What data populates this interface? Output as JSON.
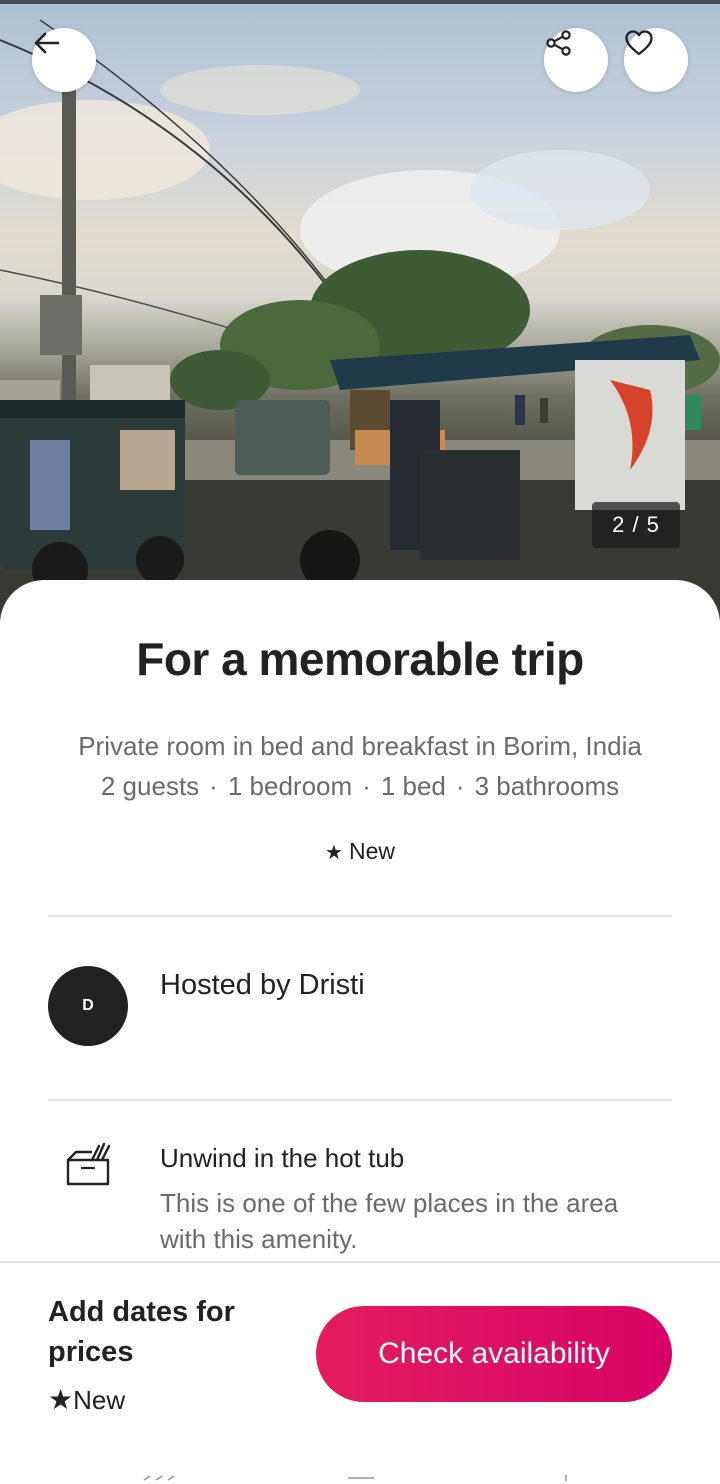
{
  "photo": {
    "counter": "2 / 5",
    "current_index": 2,
    "total": 5
  },
  "listing": {
    "title": "For a memorable trip",
    "subtitle": "Private room in bed and breakfast in Borim, India",
    "details": [
      "2 guests",
      "1 bedroom",
      "1 bed",
      "3 bathrooms"
    ],
    "detail_separator": "·",
    "rating_badge": "New"
  },
  "host": {
    "initial": "D",
    "label": "Hosted by Dristi"
  },
  "amenity": {
    "icon": "hot-tub-icon",
    "title": "Unwind in the hot tub",
    "description": "This is one of the few places in the area with this amenity."
  },
  "footer": {
    "prices_label": "Add dates for prices",
    "badge": "New",
    "cta_label": "Check availability"
  },
  "colors": {
    "brand": "#e31c5f",
    "text": "#222222",
    "muted": "#6a6a6a"
  }
}
